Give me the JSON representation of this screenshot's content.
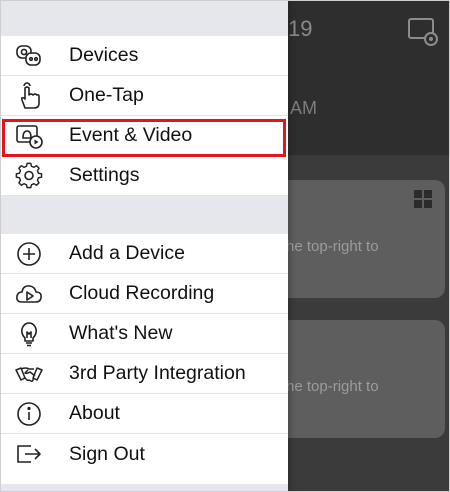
{
  "background": {
    "time_fragment": "19",
    "ampm_fragment": "AM",
    "card_hint_1": "he top-right to",
    "card_hint_2": "he top-right to"
  },
  "menu": {
    "primary": [
      {
        "label": "Devices",
        "icon": "cameras-icon"
      },
      {
        "label": "One-Tap",
        "icon": "tap-hand-icon"
      },
      {
        "label": "Event & Video",
        "icon": "event-video-icon"
      },
      {
        "label": "Settings",
        "icon": "gear-icon"
      }
    ],
    "secondary": [
      {
        "label": "Add a Device",
        "icon": "plus-circle-icon"
      },
      {
        "label": "Cloud Recording",
        "icon": "cloud-play-icon"
      },
      {
        "label": "What's New",
        "icon": "lightbulb-icon"
      },
      {
        "label": "3rd Party Integration",
        "icon": "handshake-icon"
      },
      {
        "label": "About",
        "icon": "info-icon"
      },
      {
        "label": "Sign Out",
        "icon": "sign-out-icon"
      }
    ],
    "selected": "Event & Video"
  },
  "colors": {
    "highlight": "#e3141b",
    "separator": "#e6e7ec"
  }
}
